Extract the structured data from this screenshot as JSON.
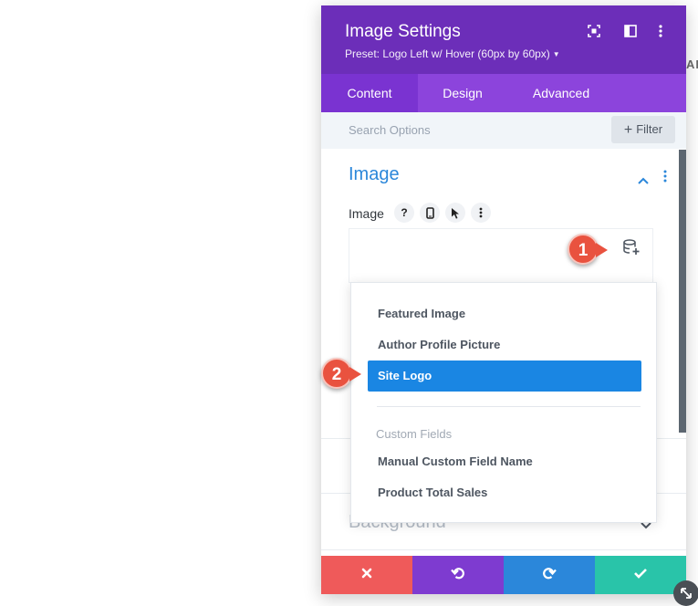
{
  "background": {
    "letters": "AB"
  },
  "panel": {
    "title": "Image Settings",
    "preset": "Preset: Logo Left w/ Hover (60px by 60px)",
    "tabs": [
      {
        "label": "Content",
        "active": true
      },
      {
        "label": "Design",
        "active": false
      },
      {
        "label": "Advanced",
        "active": false
      }
    ],
    "search": {
      "placeholder": "Search Options",
      "filter_label": "Filter"
    },
    "section": {
      "title": "Image",
      "field_label": "Image",
      "field_icons": [
        "help-icon",
        "mobile-icon",
        "hover-cursor-icon",
        "more-vertical-icon"
      ]
    },
    "collapsed_section": "Background"
  },
  "dropdown": {
    "items": [
      {
        "label": "Featured Image",
        "selected": false
      },
      {
        "label": "Author Profile Picture",
        "selected": false
      },
      {
        "label": "Site Logo",
        "selected": true
      }
    ],
    "group_label": "Custom Fields",
    "group_items": [
      {
        "label": "Manual Custom Field Name"
      },
      {
        "label": "Product Total Sales"
      }
    ]
  },
  "callouts": [
    "1",
    "2"
  ],
  "footer": {
    "buttons": [
      {
        "name": "discard-button",
        "icon": "close-icon",
        "color": "#ef5a5a"
      },
      {
        "name": "undo-button",
        "icon": "undo-icon",
        "color": "#7e3bd0"
      },
      {
        "name": "redo-button",
        "icon": "redo-icon",
        "color": "#2b87da"
      },
      {
        "name": "save-button",
        "icon": "check-icon",
        "color": "#29c4a9"
      }
    ]
  },
  "colors": {
    "header": "#6c2eb9",
    "tabs": "#8c44dc",
    "accent_blue": "#2b87da",
    "selected_item": "#1a86e3",
    "callout": "#e9523f"
  }
}
